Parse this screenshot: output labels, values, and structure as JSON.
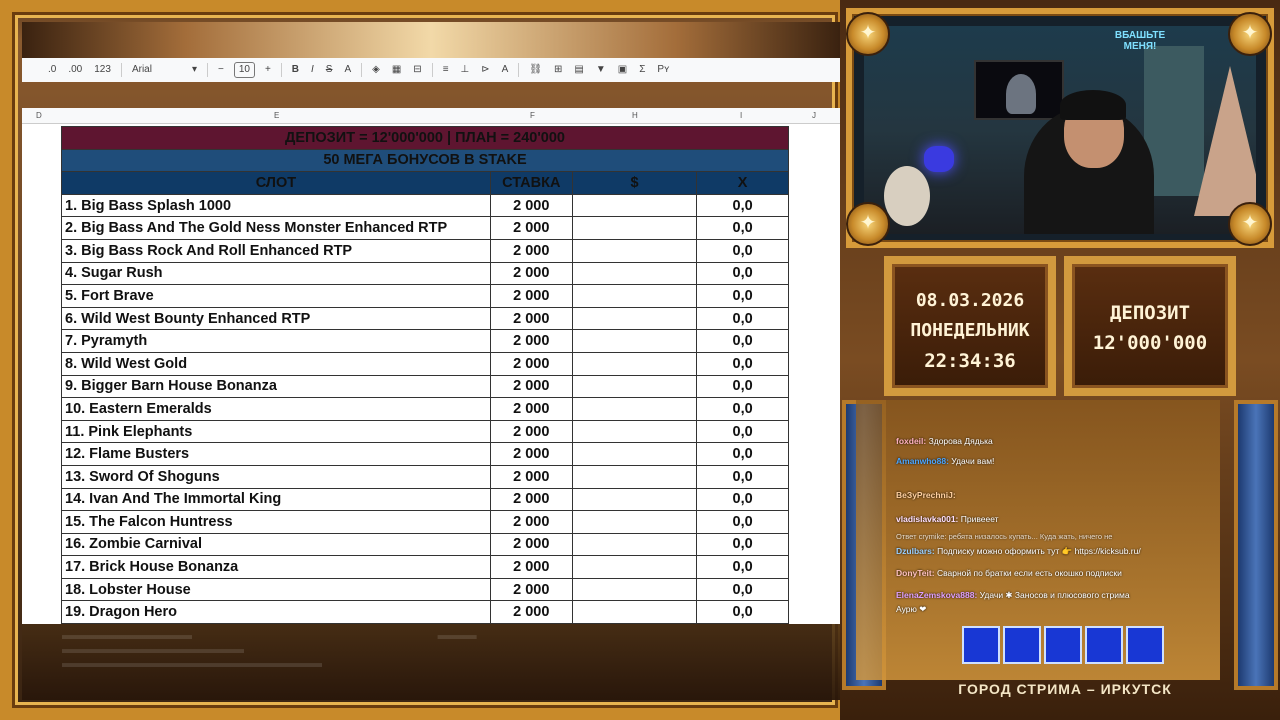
{
  "toolbar": {
    "items": [
      ".0",
      ".00",
      "123",
      "Arial",
      "−",
      "10",
      "+",
      "B",
      "I",
      "S",
      "A",
      "⌫",
      "▦",
      "⊟",
      "≡",
      "⊥",
      "⊳",
      "A",
      "⛓",
      "⊞",
      "▤",
      "▼",
      "▣",
      "Σ",
      "Рʏ"
    ],
    "font": "Arial",
    "size": "10"
  },
  "columns": [
    "D",
    "E",
    "F",
    "H",
    "I",
    "J"
  ],
  "sheet": {
    "header1": "ДЕПОЗИТ = 12'000'000 | ПЛАН = 240'000",
    "header2": "50 МЕГА БОНУСОВ В STAKE",
    "col_slot": "СЛОТ",
    "col_bet": "СТАВКА",
    "col_usd": "$",
    "col_x": "X",
    "rows": [
      {
        "name": "1. Big Bass Splash 1000",
        "bet": "2 000",
        "x": "0,0"
      },
      {
        "name": "2. Big Bass And The Gold Ness Monster Enhanced RTP",
        "bet": "2 000",
        "x": "0,0"
      },
      {
        "name": "3. Big Bass Rock And Roll Enhanced RTP",
        "bet": "2 000",
        "x": "0,0"
      },
      {
        "name": "4. Sugar Rush",
        "bet": "2 000",
        "x": "0,0"
      },
      {
        "name": "5. Fort Brave",
        "bet": "2 000",
        "x": "0,0"
      },
      {
        "name": "6. Wild West Bounty Enhanced RTP",
        "bet": "2 000",
        "x": "0,0"
      },
      {
        "name": "7. Pyramyth",
        "bet": "2 000",
        "x": "0,0"
      },
      {
        "name": "8. Wild West Gold",
        "bet": "2 000",
        "x": "0,0"
      },
      {
        "name": "9. Bigger Barn House Bonanza",
        "bet": "2 000",
        "x": "0,0"
      },
      {
        "name": "10. Eastern Emeralds",
        "bet": "2 000",
        "x": "0,0"
      },
      {
        "name": "11. Pink Elephants",
        "bet": "2 000",
        "x": "0,0"
      },
      {
        "name": "12. Flame Busters",
        "bet": "2 000",
        "x": "0,0"
      },
      {
        "name": "13. Sword Of Shoguns",
        "bet": "2 000",
        "x": "0,0"
      },
      {
        "name": "14. Ivan And The Immortal King",
        "bet": "2 000",
        "x": "0,0"
      },
      {
        "name": "15. The Falcon Huntress",
        "bet": "2 000",
        "x": "0,0"
      },
      {
        "name": "16. Zombie Carnival",
        "bet": "2 000",
        "x": "0,0"
      },
      {
        "name": "17. Brick House Bonanza",
        "bet": "2 000",
        "x": "0,0"
      },
      {
        "name": "18. Lobster House",
        "bet": "2 000",
        "x": "0,0"
      },
      {
        "name": "19. Dragon Hero",
        "bet": "2 000",
        "x": "0,0"
      }
    ]
  },
  "overlay": {
    "date": "08.03.2026",
    "weekday": "ПОНЕДЕЛЬНИК",
    "time": "22:34:36",
    "deposit_label": "ДЕПОЗИТ",
    "deposit_value": "12'000'000",
    "banner": "ГОРОД СТРИМА – ИРКУТСК",
    "cam_stamp": "ВБАШЬТЕ МЕНЯ!"
  },
  "chat": [
    {
      "user": "foxdeil:",
      "text": "Здорова Дядька"
    },
    {
      "user": "Amanwho88:",
      "text": "Удачи вам!"
    },
    {
      "user": "BeЗyPrechniJ:",
      "text": ""
    },
    {
      "user": "vladislavka001:",
      "text": "Привееет"
    },
    {
      "user": "Ответ crymike:",
      "text": "ребята низалось купать... Куда жать, ничего не"
    },
    {
      "user": "Dzulbars:",
      "text": "Подписку можно оформить тут 👉 https://kicksub.ru/"
    },
    {
      "user": "DonyTeit:",
      "text": "Сварной по братки если есть окошко подписки"
    },
    {
      "user": "ElenaZemskova888:",
      "text": "Удачи ✱ Заносов и плюсового стрима"
    },
    {
      "user": "",
      "text": "Аурю ❤"
    }
  ]
}
